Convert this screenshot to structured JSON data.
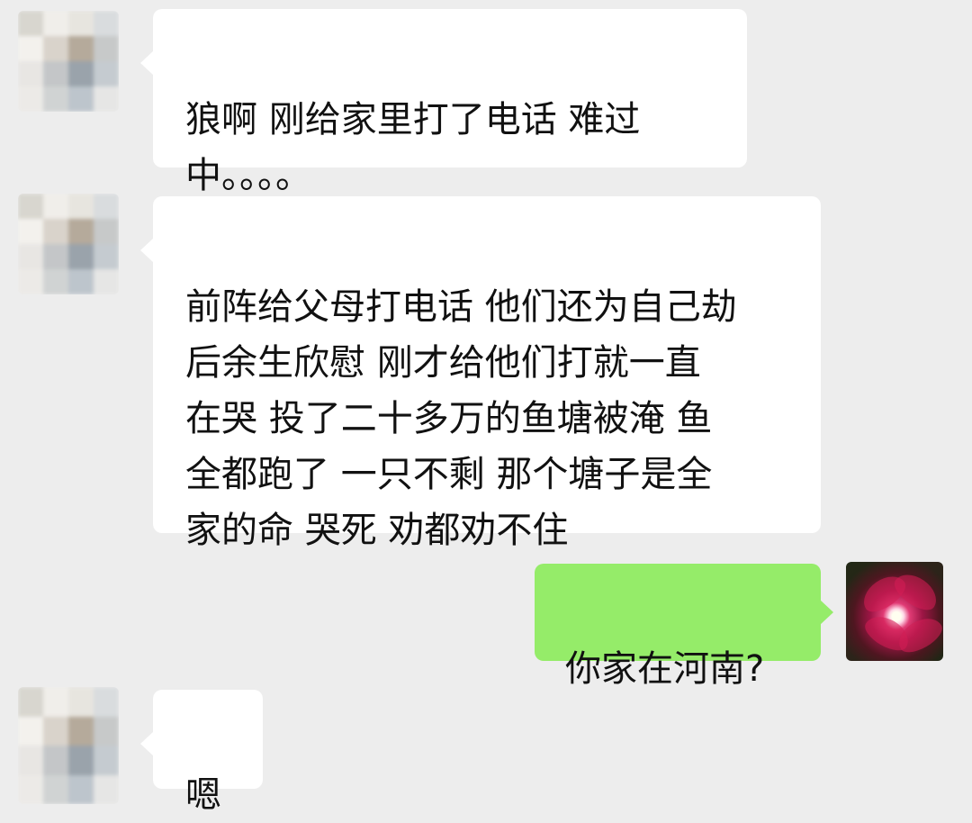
{
  "conversation": {
    "messages": [
      {
        "side": "left",
        "text": "狼啊  刚给家里打了电话  难过\n中。。。。"
      },
      {
        "side": "left",
        "text": "前阵给父母打电话 他们还为自己劫\n后余生欣慰  刚才给他们打就一直\n在哭 投了二十多万的鱼塘被淹  鱼\n全都跑了 一只不剩  那个塘子是全\n家的命 哭死   劝都劝不住"
      },
      {
        "side": "right",
        "text": "你家在河南?"
      },
      {
        "side": "left",
        "text": "嗯"
      }
    ]
  },
  "colors": {
    "background": "#ededed",
    "incoming_bubble": "#ffffff",
    "outgoing_bubble": "#95ec69",
    "text": "#111111"
  },
  "icons": {
    "incoming_avatar": "blurred-avatar-icon",
    "outgoing_avatar": "photo-avatar-icon"
  }
}
